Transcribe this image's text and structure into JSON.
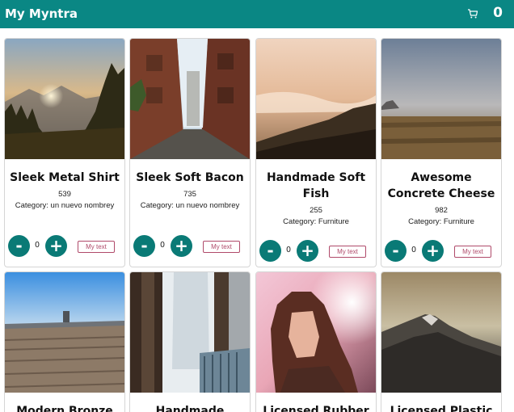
{
  "app": {
    "title": "My Myntra",
    "cart_count": "0",
    "cart_icon": "cart-icon",
    "brand_color": "#0a8784"
  },
  "products": [
    {
      "name": "Sleek Metal Shirt",
      "price": "539",
      "category": "Category: un nuevo nombrey",
      "qty": "0",
      "minus_label": "-",
      "plus_label": "+",
      "button_label": "My text",
      "image": "forest-sunset-mountains"
    },
    {
      "name": "Sleek Soft Bacon",
      "price": "735",
      "category": "Category: un nuevo nombrey",
      "qty": "0",
      "minus_label": "-",
      "plus_label": "+",
      "button_label": "My text",
      "image": "brick-alley-street"
    },
    {
      "name": "Handmade Soft Fish",
      "price": "255",
      "category": "Category: Furniture",
      "qty": "0",
      "minus_label": "-",
      "plus_label": "+",
      "button_label": "My text",
      "image": "misty-hills-sunrise"
    },
    {
      "name": "Awesome Concrete Cheese",
      "price": "982",
      "category": "Category: Furniture",
      "qty": "0",
      "minus_label": "-",
      "plus_label": "+",
      "button_label": "My text",
      "image": "foggy-plain-hill"
    },
    {
      "name": "Modern Bronze",
      "image": "wooden-pier-sky"
    },
    {
      "name": "Handmade",
      "image": "window-curtain-chair"
    },
    {
      "name": "Licensed Rubber",
      "image": "woman-portrait-light"
    },
    {
      "name": "Licensed Plastic",
      "image": "cloudy-mountain-peak"
    }
  ]
}
